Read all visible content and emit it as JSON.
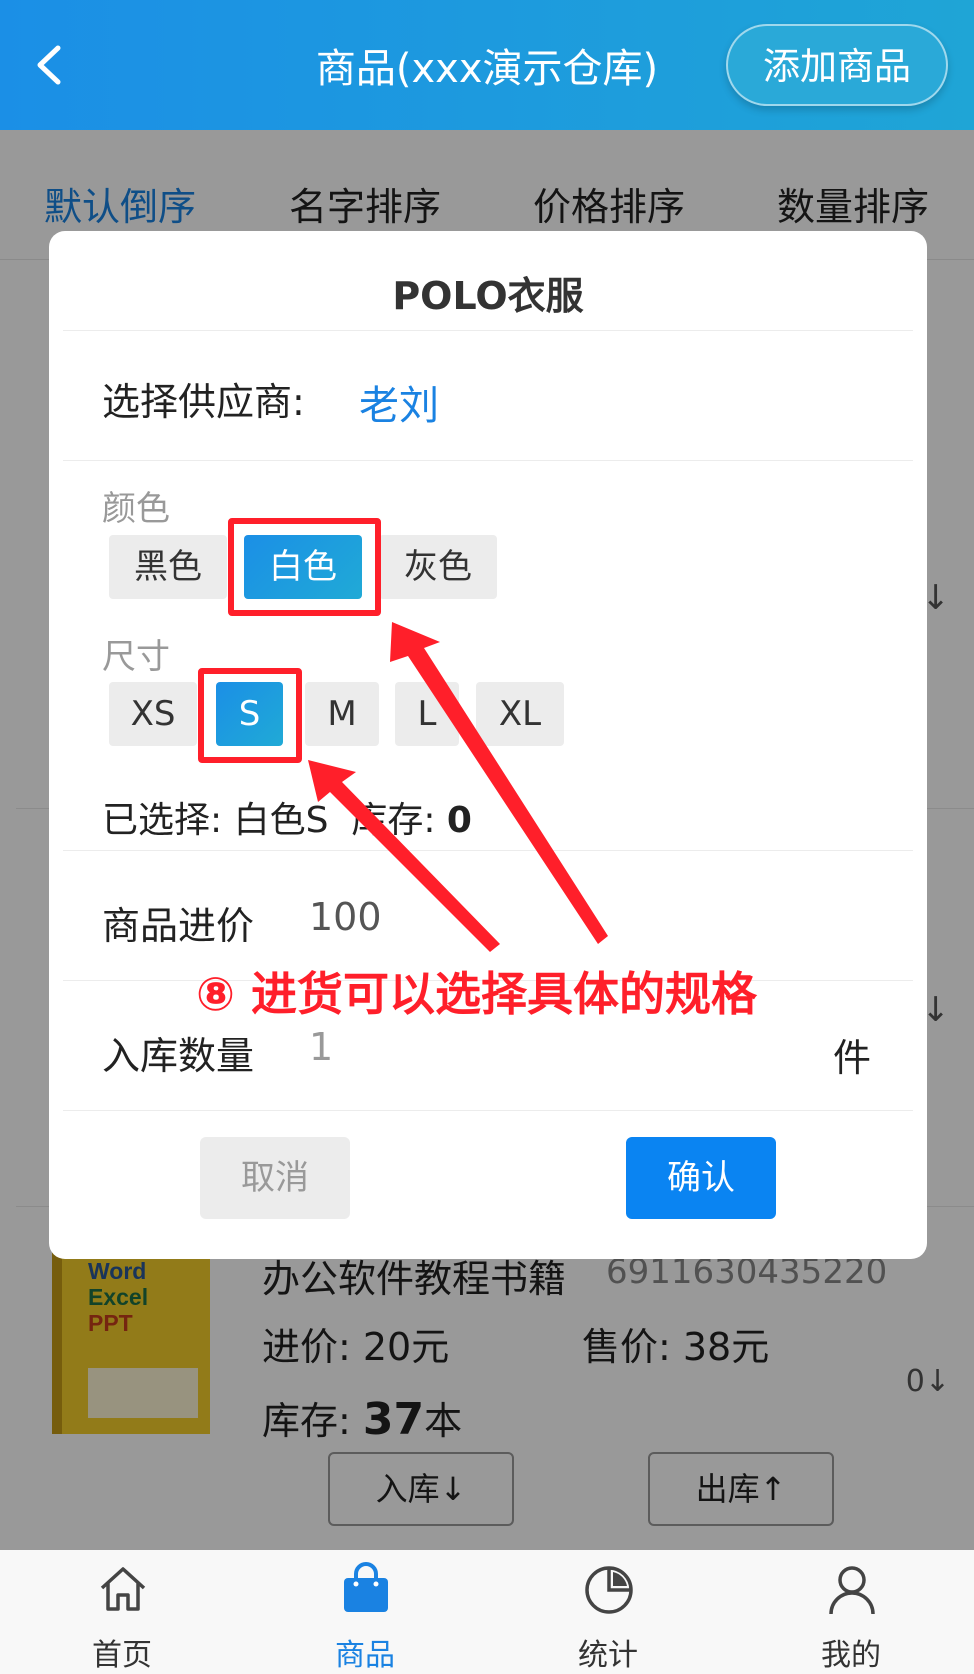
{
  "header": {
    "title": "商品(xxx演示仓库)",
    "add_button": "添加商品"
  },
  "sort_tabs": [
    "默认倒序",
    "名字排序",
    "价格排序",
    "数量排序"
  ],
  "background_item": {
    "title": "办公软件教程书籍",
    "code": "6911630435220",
    "cost": "进价: 20元",
    "price": "售价: 38元",
    "stock_prefix": "库存:",
    "stock_value": "37",
    "stock_unit": "本",
    "right_value": "0↓",
    "stock_in_button": "入库↓",
    "stock_out_button": "出库↑",
    "side_arrow": "↓"
  },
  "dialog": {
    "title": "POLO衣服",
    "supplier_label": "选择供应商:",
    "supplier_value": "老刘",
    "color_label": "颜色",
    "colors": [
      "黑色",
      "白色",
      "灰色"
    ],
    "selected_color_index": 1,
    "size_label": "尺寸",
    "sizes": [
      "XS",
      "S",
      "M",
      "L",
      "XL"
    ],
    "selected_size_index": 1,
    "selected_prefix": "已选择: 白色S",
    "stock_label": "库存:",
    "stock_value": "0",
    "price_label": "商品进价",
    "price_value": "100",
    "qty_label": "入库数量",
    "qty_value": "1",
    "qty_unit": "件",
    "cancel": "取消",
    "confirm": "确认"
  },
  "annotation": {
    "text": "⑧ 进货可以选择具体的规格",
    "color": "#ff1f2a"
  },
  "tabbar": {
    "items": [
      {
        "label": "首页",
        "icon": "home-icon"
      },
      {
        "label": "商品",
        "icon": "shopping-bag-icon"
      },
      {
        "label": "统计",
        "icon": "pie-chart-icon"
      },
      {
        "label": "我的",
        "icon": "user-icon"
      }
    ],
    "active_index": 1
  },
  "colors": {
    "primary": "#1a82e2",
    "confirm": "#0a84f2",
    "header_start": "#1b8fe6",
    "header_end": "#1fa5d6"
  }
}
